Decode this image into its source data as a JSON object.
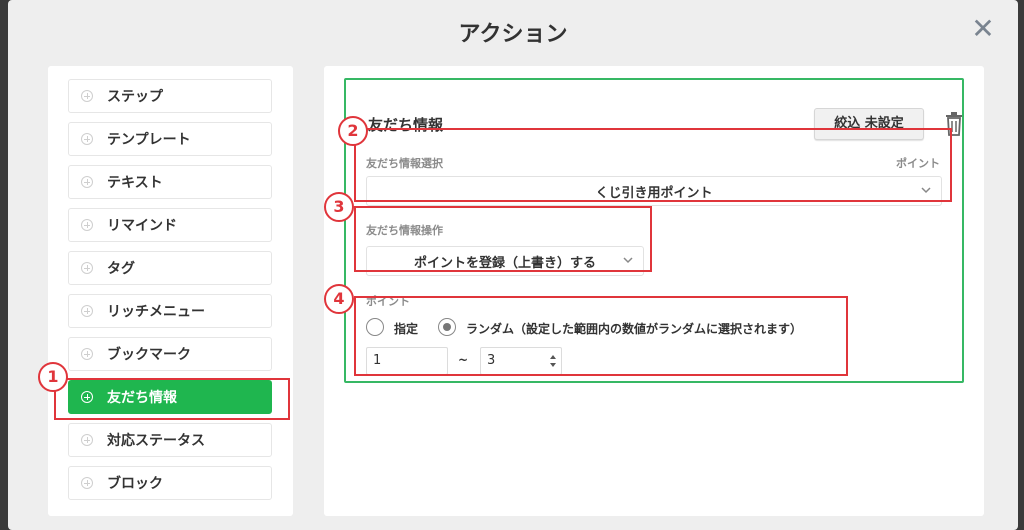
{
  "modal": {
    "title": "アクション",
    "close_symbol": "✕"
  },
  "menu": {
    "items": [
      {
        "label": "ステップ"
      },
      {
        "label": "テンプレート"
      },
      {
        "label": "テキスト"
      },
      {
        "label": "リマインド"
      },
      {
        "label": "タグ"
      },
      {
        "label": "リッチメニュー"
      },
      {
        "label": "ブックマーク"
      },
      {
        "label": "友だち情報",
        "active": true
      },
      {
        "label": "対応ステータス"
      },
      {
        "label": "ブロック"
      }
    ]
  },
  "panel": {
    "title": "友だち情報",
    "filter_button": "絞込 未設定",
    "select_label": "友だち情報選択",
    "select_right_label": "ポイント",
    "select_value": "くじ引き用ポイント",
    "operation_label": "友だち情報操作",
    "operation_value": "ポイントを登録（上書き）する",
    "point_label": "ポイント",
    "radio_specify": "指定",
    "radio_random": "ランダム（設定した範囲内の数値がランダムに選択されます）",
    "range_min": "1",
    "range_sep": "~",
    "range_max": "3"
  },
  "annotations": {
    "badge_1": "1",
    "badge_2": "2",
    "badge_3": "3",
    "badge_4": "4"
  },
  "colors": {
    "accent_green": "#1fb64f",
    "annotation_red": "#e0353b"
  }
}
